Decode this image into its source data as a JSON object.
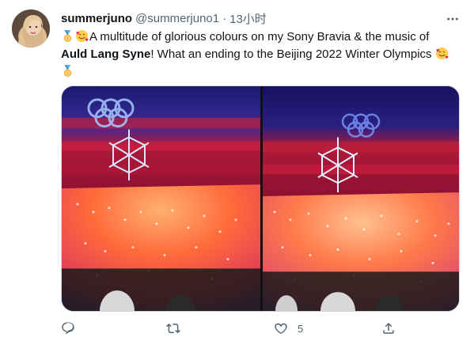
{
  "author": {
    "name": "summerjuno",
    "handle": "@summerjuno1",
    "separator": "·",
    "time": "13小时"
  },
  "tweet": {
    "emoji_1": "medal",
    "emoji_2": "smiling-face-with-hearts",
    "text_part1": "A multitude of glorious colours on my Sony Bravia & the music of ",
    "text_bold": "Auld Lang Syne",
    "text_part2": "! What an ending to the Beijing 2022 Winter Olympics "
  },
  "actions": {
    "reply_count": "",
    "retweet_count": "",
    "like_count": "5",
    "share_count": ""
  },
  "colors": {
    "accent": "#1d9bf0",
    "text_secondary": "#536471",
    "border": "#cfd9de"
  }
}
